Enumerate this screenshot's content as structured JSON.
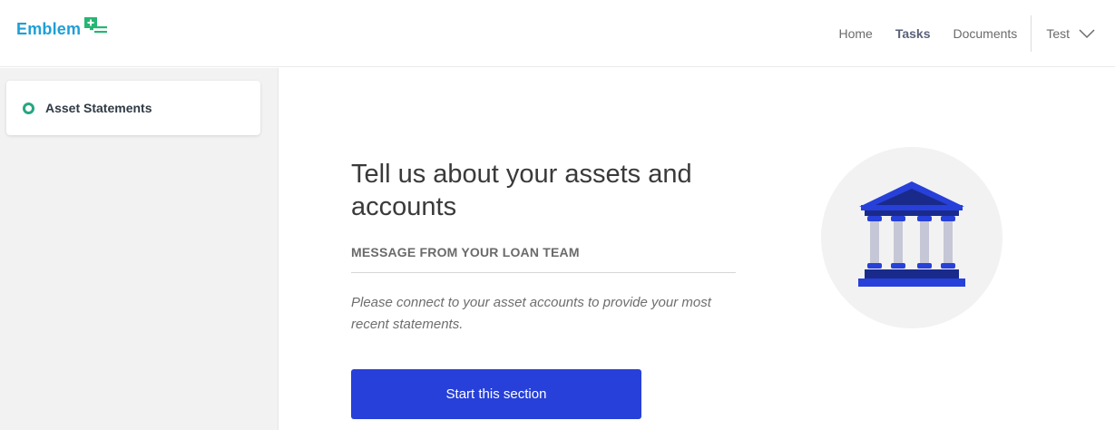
{
  "header": {
    "logo_text": "Emblem",
    "nav": {
      "home": "Home",
      "tasks": "Tasks",
      "documents": "Documents"
    },
    "user_name": "Test"
  },
  "sidebar": {
    "items": [
      {
        "label": "Asset Statements"
      }
    ]
  },
  "main": {
    "title": "Tell us about your assets and accounts",
    "message_label": "MESSAGE FROM YOUR LOAN TEAM",
    "message_body": "Please connect to your asset accounts to provide your most recent statements.",
    "start_button": "Start this section",
    "illustration_icon": "bank-icon"
  },
  "colors": {
    "brand": "#1e9fd6",
    "brand_mark": "#27b573",
    "primary_button": "#2740d9",
    "status_ring": "#27a680"
  }
}
